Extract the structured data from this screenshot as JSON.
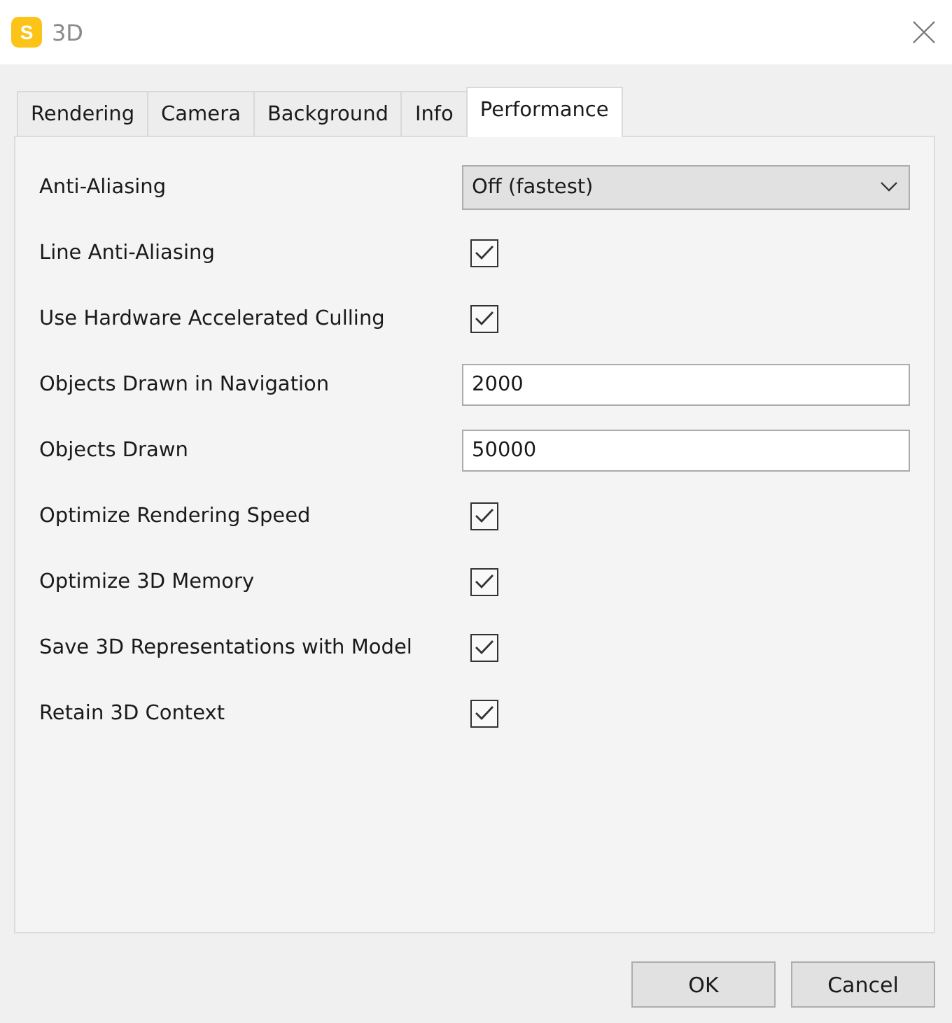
{
  "window": {
    "icon_letter": "S",
    "title": "3D"
  },
  "tabs": [
    {
      "label": "Rendering",
      "selected": false
    },
    {
      "label": "Camera",
      "selected": false
    },
    {
      "label": "Background",
      "selected": false
    },
    {
      "label": "Info",
      "selected": false
    },
    {
      "label": "Performance",
      "selected": true
    }
  ],
  "settings": [
    {
      "kind": "dropdown",
      "label": "Anti-Aliasing",
      "value": "Off (fastest)"
    },
    {
      "kind": "checkbox",
      "label": "Line Anti-Aliasing",
      "checked": true
    },
    {
      "kind": "checkbox",
      "label": "Use Hardware Accelerated Culling",
      "checked": true
    },
    {
      "kind": "input",
      "label": "Objects Drawn in Navigation",
      "value": "2000"
    },
    {
      "kind": "input",
      "label": "Objects Drawn",
      "value": "50000"
    },
    {
      "kind": "checkbox",
      "label": "Optimize Rendering Speed",
      "checked": true
    },
    {
      "kind": "checkbox",
      "label": "Optimize 3D Memory",
      "checked": true
    },
    {
      "kind": "checkbox",
      "label": "Save 3D Representations with Model",
      "checked": true
    },
    {
      "kind": "checkbox",
      "label": "Retain 3D Context",
      "checked": true
    }
  ],
  "buttons": [
    "OK",
    "Cancel"
  ]
}
